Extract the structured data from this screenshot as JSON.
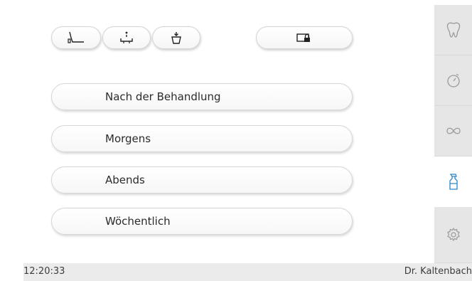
{
  "top_bar": {
    "buttons": [
      {
        "icon": "chair-recline-icon"
      },
      {
        "icon": "chair-flat-icon"
      },
      {
        "icon": "rinse-cup-icon"
      },
      {
        "icon": "lock-screen-icon"
      }
    ]
  },
  "menu": {
    "items": [
      {
        "label": "Nach der Behandlung"
      },
      {
        "label": "Morgens"
      },
      {
        "label": "Abends"
      },
      {
        "label": "Wöchentlich"
      }
    ]
  },
  "sidebar": {
    "tabs": [
      {
        "icon": "tooth-icon",
        "active": false
      },
      {
        "icon": "timer-icon",
        "active": false
      },
      {
        "icon": "infinity-icon",
        "active": false
      },
      {
        "icon": "spray-bottle-icon",
        "active": true
      },
      {
        "icon": "settings-gear-icon",
        "active": false
      }
    ]
  },
  "status_bar": {
    "time": "12:20:33",
    "user": "Dr. Kaltenbach"
  },
  "colors": {
    "accent_blue": "#2a86c9",
    "panel_bg": "#ffffff",
    "sidebar_bg": "#e6e6e6",
    "status_bg": "#ebebeb"
  }
}
